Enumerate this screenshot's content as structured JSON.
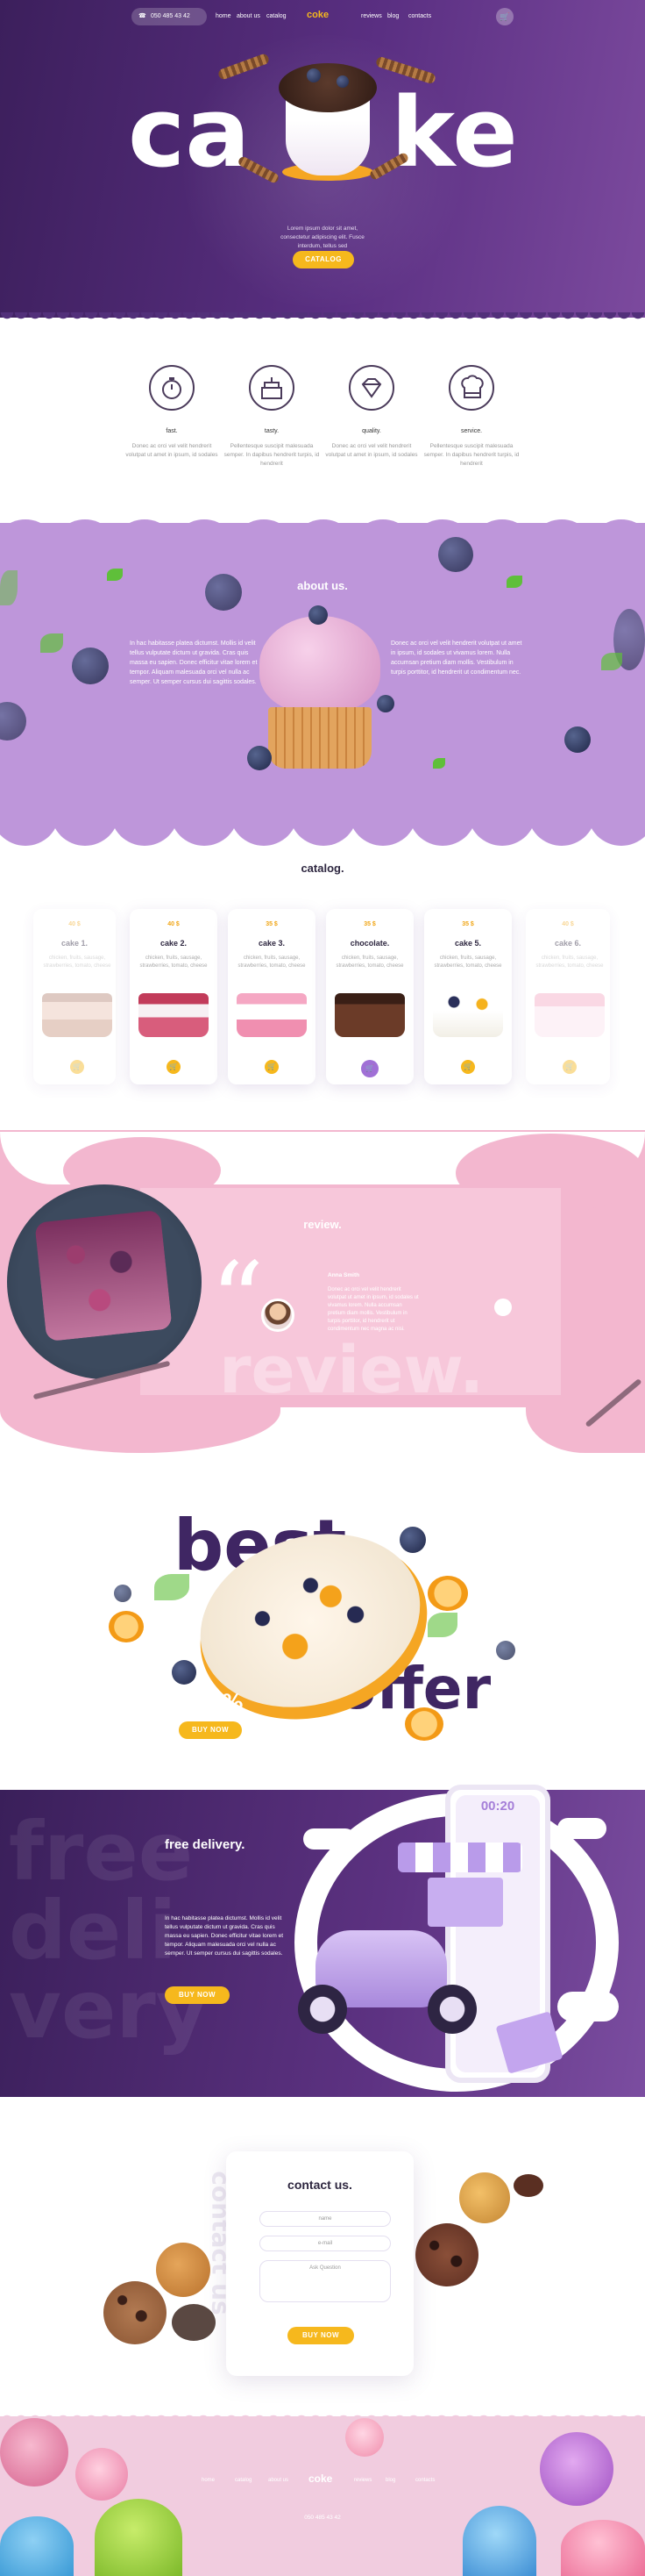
{
  "nav": {
    "phone": "050 485 43 42",
    "links_left": [
      "home",
      "about us",
      "catalog"
    ],
    "links_right": [
      "reviews",
      "blog",
      "contacts"
    ],
    "logo": "coke"
  },
  "hero": {
    "word_left": "ca",
    "word_right": "ke",
    "text": "Lorem ipsum dolor sit amet, consectetur adipiscing elit. Fusce interdum, tellus sed",
    "button": "catalog"
  },
  "features": [
    {
      "title": "fast.",
      "text": "Donec ac orci vel velit hendrerit volutpat ut amet in ipsum, id sodales"
    },
    {
      "title": "tasty.",
      "text": "Pellentesque suscipit malesuada semper. In dapibus hendrerit turpis, id hendrerit"
    },
    {
      "title": "quality.",
      "text": "Donec ac orci vel velit hendrerit volutpat ut amet in ipsum, id sodales"
    },
    {
      "title": "service.",
      "text": "Pellentesque suscipit malesuada semper. In dapibus hendrerit turpis, id hendrerit"
    }
  ],
  "about": {
    "title": "about us.",
    "left_text": "In hac habitasse platea dictumst. Mollis id velit tellus vulputate dictum ut gravida. Cras quis massa eu sapien. Donec efficitur vitae lorem et tempor. Aliquam malesuada orci vel nulla ac semper. Ut semper cursus dui sagittis sodales.",
    "right_text": "Donec ac orci vel velit hendrerit volutpat ut amet in ipsum, id sodales ut vivamus lorem. Nulla accumsan pretium diam mollis. Vestibulum in turpis porttitor, id hendrerit ut condimentum nec."
  },
  "catalog": {
    "title": "catalog.",
    "items": [
      {
        "price": "40 $",
        "name": "cake 1.",
        "desc": "chicken, fruits, sausage, strawberries, tomato, cheese"
      },
      {
        "price": "40 $",
        "name": "cake 2.",
        "desc": "chicken, fruits, sausage, strawberries, tomato, cheese"
      },
      {
        "price": "35 $",
        "name": "cake 3.",
        "desc": "chicken, fruits, sausage, strawberries, tomato, cheese"
      },
      {
        "price": "35 $",
        "name": "chocolate.",
        "desc": "chicken, fruits, sausage, strawberries, tomato, cheese"
      },
      {
        "price": "35 $",
        "name": "cake 5.",
        "desc": "chicken, fruits, sausage, strawberries, tomato, cheese"
      },
      {
        "price": "40 $",
        "name": "cake 6.",
        "desc": "chicken, fruits, sausage, strawberries, tomato, cheese"
      }
    ],
    "cart_icon": "cart-icon"
  },
  "review": {
    "title": "review.",
    "bg_word": "review.",
    "author": "Anna Smith",
    "text": "Donec ac orci vel velit hendrerit volutpat ut amet in ipsum, id sodales ut vivamus lorem. Nulla accumsan pretium diam mollis. Vestibulum in turpis porttitor, id hendrerit ut condimentum nec magna ac nisi."
  },
  "offer": {
    "word1": "best",
    "word2": "offer",
    "discount": "-50%",
    "button": "buy now"
  },
  "delivery": {
    "bg_word1": "free",
    "bg_word2": "deli",
    "bg_word3": "very",
    "title": "free delivery.",
    "text": "In hac habitasse platea dictumst. Mollis id velit tellus vulputate dictum ut gravida. Cras quis massa eu sapien. Donec efficitur vitae lorem et tempor. Aliquam malesuada orci vel nulla ac semper. Ut semper cursus dui sagittis sodales.",
    "button": "buy now",
    "phone_time": "00:20"
  },
  "contact": {
    "title": "contact us.",
    "side_word": "contact us",
    "name_ph": "name",
    "email_ph": "e-mail",
    "question_ph": "Ask Question",
    "button": "buy now"
  },
  "footer": {
    "links_left": [
      "home",
      "catalog",
      "about us"
    ],
    "logo": "coke",
    "links_right": [
      "reviews",
      "blog",
      "contacts"
    ],
    "phone": "050 485 43 42"
  },
  "colors": {
    "accent": "#f6b81d",
    "purple": "#5a2f82",
    "lavender": "#be96da",
    "pink": "#f3b7cf"
  }
}
